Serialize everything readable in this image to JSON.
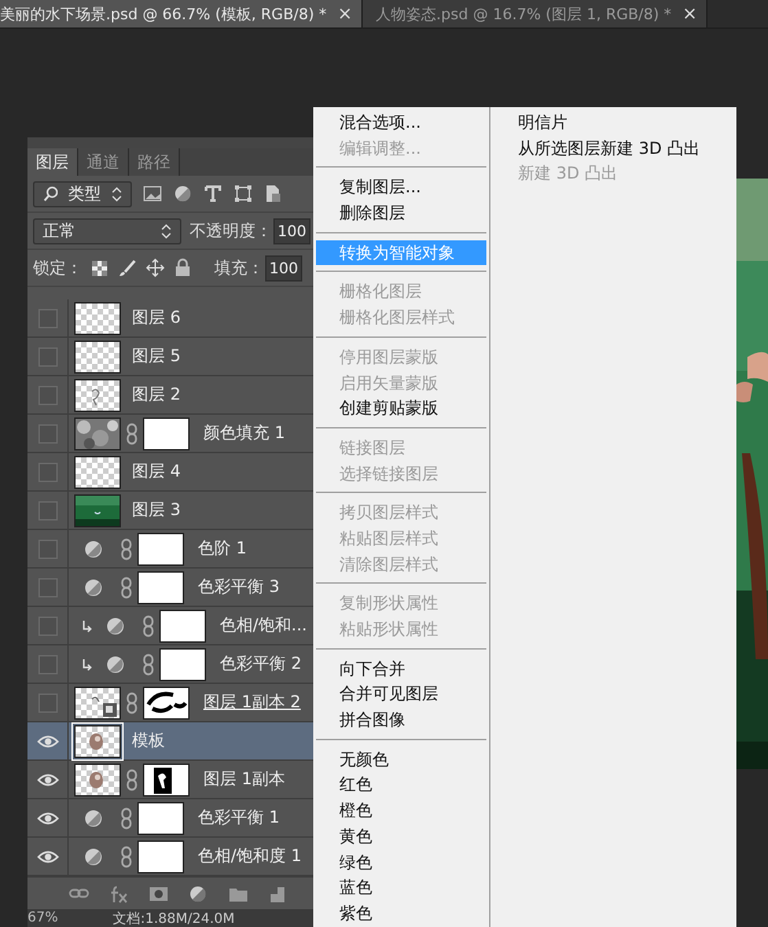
{
  "document_tabs": [
    {
      "title": "美丽的水下场景.psd @ 66.7% (模板, RGB/8) *",
      "close": "×",
      "selected": true
    },
    {
      "title": "人物姿态.psd @ 16.7% (图层 1, RGB/8) *",
      "close": "×",
      "selected": false
    }
  ],
  "layers_panel": {
    "tabs": [
      {
        "label": "图层",
        "selected": true
      },
      {
        "label": "通道",
        "selected": false
      },
      {
        "label": "路径",
        "selected": false
      }
    ],
    "filter": "类型",
    "blend_mode": "正常",
    "opacity_label": "不透明度：",
    "opacity": "100",
    "lock_label": "锁定：",
    "fill_label": "填充：",
    "fill": "100",
    "layers": [
      {
        "name": "图层 6",
        "visible": false,
        "kind": "pixel",
        "thumbnail": {
          "kind": "checker"
        },
        "clipped": false,
        "clip_base": false,
        "selected": false
      },
      {
        "name": "图层 5",
        "visible": false,
        "kind": "pixel",
        "thumbnail": {
          "kind": "checker"
        },
        "clipped": false,
        "clip_base": false,
        "selected": false
      },
      {
        "name": "图层 2",
        "visible": false,
        "kind": "pixel",
        "thumbnail": {
          "kind": "sketch"
        },
        "clipped": false,
        "clip_base": false,
        "selected": false
      },
      {
        "name": "颜色填充 1",
        "visible": false,
        "kind": "fill",
        "thumbnail": {
          "kind": "texture"
        },
        "mask": {
          "kind": "white"
        },
        "clipped": false,
        "clip_base": false,
        "selected": false
      },
      {
        "name": "图层 4",
        "visible": false,
        "kind": "pixel",
        "thumbnail": {
          "kind": "checker"
        },
        "clipped": false,
        "clip_base": false,
        "selected": false
      },
      {
        "name": "图层 3",
        "visible": false,
        "kind": "pixel",
        "thumbnail": {
          "kind": "green"
        },
        "clipped": false,
        "clip_base": false,
        "selected": false
      },
      {
        "name": "色阶 1",
        "visible": false,
        "kind": "adjustment",
        "mask": {
          "kind": "white"
        },
        "clipped": false,
        "clip_base": false,
        "selected": false
      },
      {
        "name": "色彩平衡 3",
        "visible": false,
        "kind": "adjustment",
        "mask": {
          "kind": "white"
        },
        "clipped": false,
        "clip_base": false,
        "selected": false
      },
      {
        "name": "色相/饱和...",
        "visible": false,
        "kind": "adjustment",
        "mask": {
          "kind": "white"
        },
        "clipped": true,
        "clip_base": false,
        "selected": false
      },
      {
        "name": "色彩平衡 2",
        "visible": false,
        "kind": "adjustment",
        "mask": {
          "kind": "white"
        },
        "clipped": true,
        "clip_base": false,
        "selected": false
      },
      {
        "name": "图层 1副本 2",
        "visible": false,
        "kind": "fill",
        "thumbnail": {
          "kind": "smart"
        },
        "mask": {
          "kind": "brush"
        },
        "clipped": false,
        "clip_base": true,
        "selected": false
      },
      {
        "name": "模板",
        "visible": true,
        "kind": "pixel",
        "thumbnail": {
          "kind": "figure"
        },
        "clipped": false,
        "clip_base": false,
        "selected": true
      },
      {
        "name": "图层 1副本",
        "visible": true,
        "kind": "fill",
        "thumbnail": {
          "kind": "figure"
        },
        "mask": {
          "kind": "figure"
        },
        "clipped": false,
        "clip_base": false,
        "selected": false
      },
      {
        "name": "色彩平衡 1",
        "visible": true,
        "kind": "adjustment",
        "mask": {
          "kind": "white"
        },
        "clipped": false,
        "clip_base": false,
        "selected": false
      },
      {
        "name": "色相/饱和度 1",
        "visible": true,
        "kind": "adjustment",
        "mask": {
          "kind": "white"
        },
        "clipped": false,
        "clip_base": false,
        "selected": false
      }
    ]
  },
  "context_menu": {
    "groups": [
      [
        {
          "label": "混合选项...",
          "disabled": false,
          "selected": false
        },
        {
          "label": "编辑调整...",
          "disabled": true,
          "selected": false
        }
      ],
      [
        {
          "label": "复制图层...",
          "disabled": false,
          "selected": false
        },
        {
          "label": "删除图层",
          "disabled": false,
          "selected": false
        }
      ],
      [
        {
          "label": "转换为智能对象",
          "disabled": false,
          "selected": true
        }
      ],
      [
        {
          "label": "栅格化图层",
          "disabled": true,
          "selected": false
        },
        {
          "label": "栅格化图层样式",
          "disabled": true,
          "selected": false
        }
      ],
      [
        {
          "label": "停用图层蒙版",
          "disabled": true,
          "selected": false
        },
        {
          "label": "启用矢量蒙版",
          "disabled": true,
          "selected": false
        },
        {
          "label": "创建剪贴蒙版",
          "disabled": false,
          "selected": false
        }
      ],
      [
        {
          "label": "链接图层",
          "disabled": true,
          "selected": false
        },
        {
          "label": "选择链接图层",
          "disabled": true,
          "selected": false
        }
      ],
      [
        {
          "label": "拷贝图层样式",
          "disabled": true,
          "selected": false
        },
        {
          "label": "粘贴图层样式",
          "disabled": true,
          "selected": false
        },
        {
          "label": "清除图层样式",
          "disabled": true,
          "selected": false
        }
      ],
      [
        {
          "label": "复制形状属性",
          "disabled": true,
          "selected": false
        },
        {
          "label": "粘贴形状属性",
          "disabled": true,
          "selected": false
        }
      ],
      [
        {
          "label": "向下合并",
          "disabled": false,
          "selected": false
        },
        {
          "label": "合并可见图层",
          "disabled": false,
          "selected": false
        },
        {
          "label": "拼合图像",
          "disabled": false,
          "selected": false
        }
      ],
      [
        {
          "label": "无颜色",
          "disabled": false,
          "selected": false
        },
        {
          "label": "红色",
          "disabled": false,
          "selected": false
        },
        {
          "label": "橙色",
          "disabled": false,
          "selected": false
        },
        {
          "label": "黄色",
          "disabled": false,
          "selected": false
        },
        {
          "label": "绿色",
          "disabled": false,
          "selected": false
        },
        {
          "label": "蓝色",
          "disabled": false,
          "selected": false
        },
        {
          "label": "紫色",
          "disabled": false,
          "selected": false
        }
      ]
    ],
    "side_items": [
      {
        "label": "明信片",
        "disabled": false
      },
      {
        "label": "从所选图层新建 3D 凸出",
        "disabled": false
      },
      {
        "label": "新建 3D 凸出",
        "disabled": true
      }
    ]
  },
  "status_bar": {
    "zoom": "67%",
    "document": "文档:1.88M/24.0M"
  }
}
